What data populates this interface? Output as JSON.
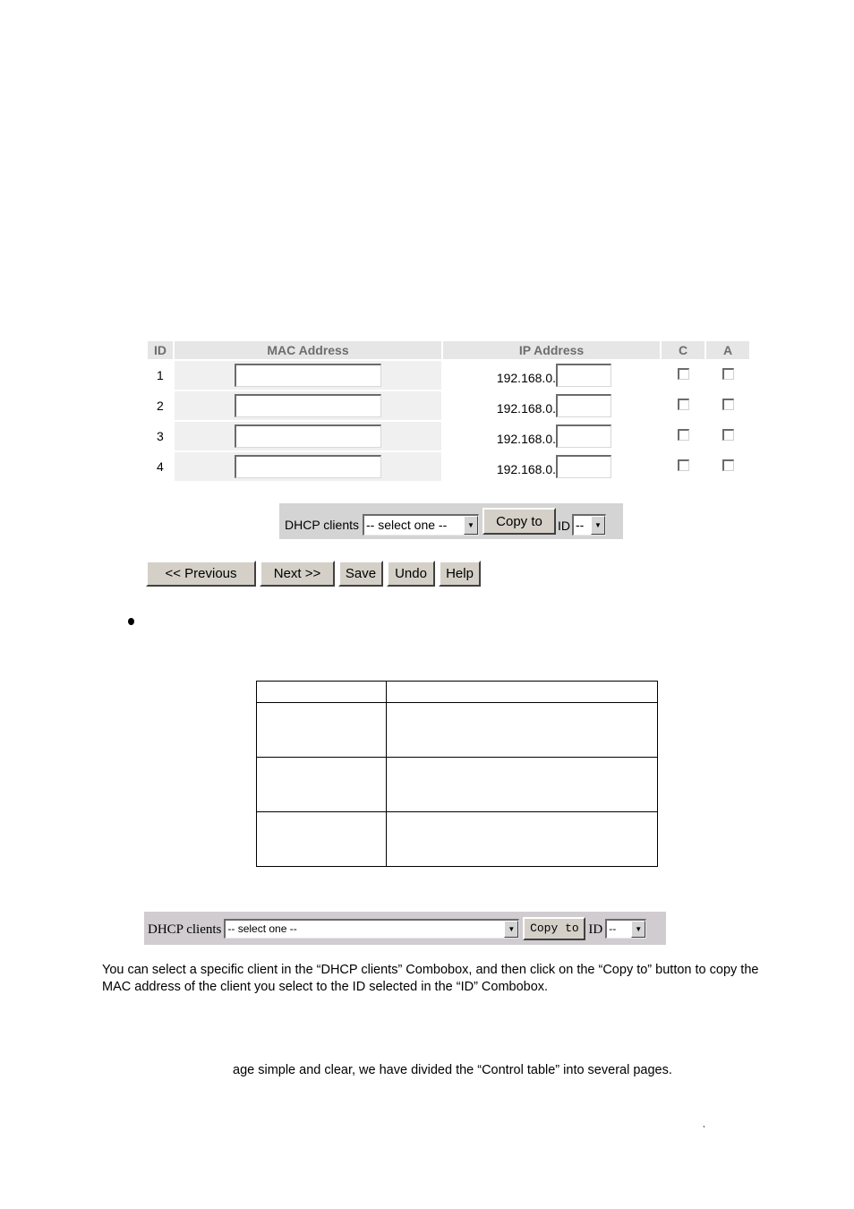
{
  "control_table": {
    "headers": {
      "id": "ID",
      "mac": "MAC Address",
      "ip": "IP Address",
      "c": "C",
      "a": "A"
    },
    "rows": [
      {
        "id": "1",
        "mac": "",
        "ip_prefix": "192.168.0.",
        "ip_suffix": "",
        "c_checked": false,
        "a_checked": false
      },
      {
        "id": "2",
        "mac": "",
        "ip_prefix": "192.168.0.",
        "ip_suffix": "",
        "c_checked": false,
        "a_checked": false
      },
      {
        "id": "3",
        "mac": "",
        "ip_prefix": "192.168.0.",
        "ip_suffix": "",
        "c_checked": false,
        "a_checked": false
      },
      {
        "id": "4",
        "mac": "",
        "ip_prefix": "192.168.0.",
        "ip_suffix": "",
        "c_checked": false,
        "a_checked": false
      }
    ]
  },
  "dhcp_bar": {
    "label": "DHCP clients",
    "clients_selected": "-- select one --",
    "copy_button": "Copy to",
    "id_label": "ID",
    "id_selected": "--"
  },
  "nav_buttons": {
    "previous": "<< Previous",
    "next": "Next >>",
    "save": "Save",
    "undo": "Undo",
    "help": "Help"
  },
  "dhcp_bar_zoomed": {
    "label": "DHCP clients",
    "clients_selected": "-- select one --",
    "copy_button": "Copy to",
    "id_label": "ID",
    "id_selected": "--"
  },
  "text": {
    "paragraph1": "You can select a specific client in the “DHCP clients” Combobox, and then click on the “Copy to” button to copy the MAC address of the client you select to the ID selected in the “ID” Combobox.",
    "paragraph2": "age simple and clear, we have divided the “Control table” into several pages.",
    "stray_mark": ","
  }
}
